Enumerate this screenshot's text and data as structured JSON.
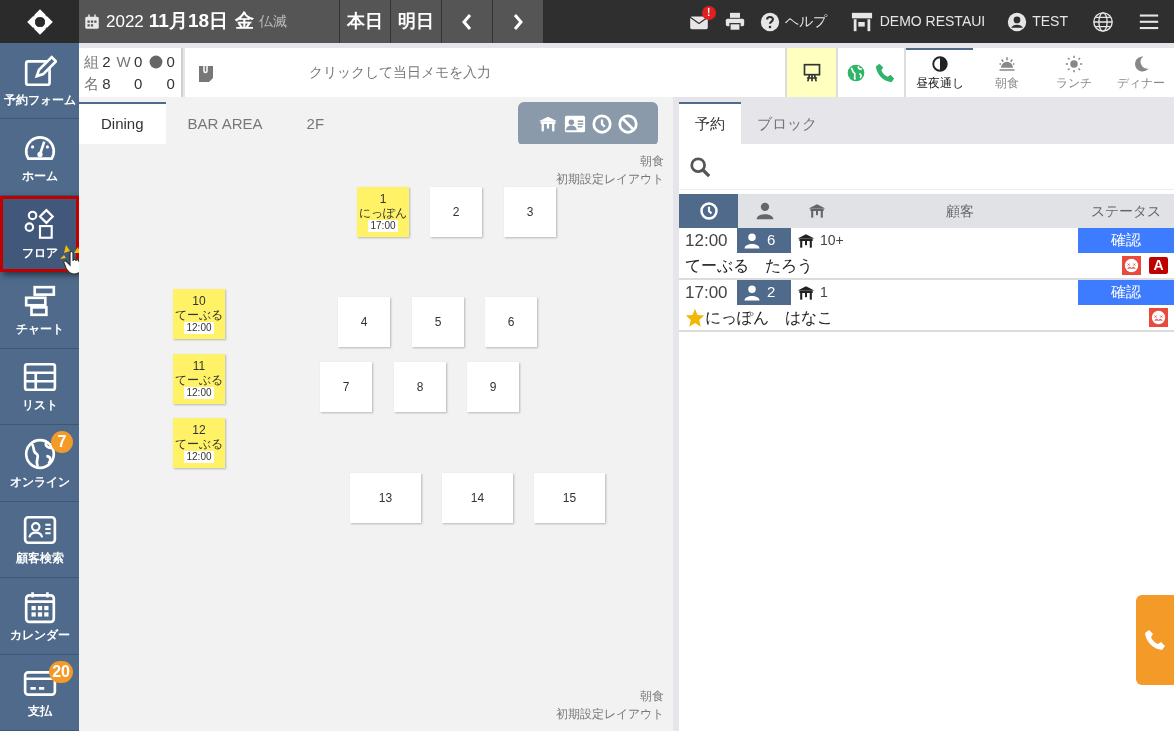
{
  "header": {
    "year": "2022",
    "date": "11月18日",
    "weekday": "金",
    "rokuyo": "仏滅",
    "buttons": [
      "本日",
      "明日"
    ],
    "mail_badge": "!",
    "help": "ヘルプ",
    "store": "DEMO RESTAUI",
    "user": "TEST"
  },
  "sidebar": {
    "items": [
      {
        "kind": "form",
        "label": "予約フォーム",
        "selected": false
      },
      {
        "kind": "home",
        "label": "ホーム",
        "selected": false
      },
      {
        "kind": "floor",
        "label": "フロア",
        "selected": true
      },
      {
        "kind": "chart",
        "label": "チャート",
        "selected": false
      },
      {
        "kind": "list",
        "label": "リスト",
        "selected": false
      },
      {
        "kind": "online",
        "label": "オンライン",
        "selected": false,
        "badge": "7"
      },
      {
        "kind": "customer",
        "label": "顧客検索",
        "selected": false
      },
      {
        "kind": "calendar",
        "label": "カレンダー",
        "selected": false
      },
      {
        "kind": "payment",
        "label": "支払",
        "selected": false,
        "badge": "20"
      }
    ]
  },
  "summary": {
    "groups_label": "組",
    "groups": "2",
    "walkin_label": "W",
    "walkin_groups": "0",
    "online_groups": "0",
    "people_label": "名",
    "people": "8",
    "walkin_people": "0",
    "online_people": "0"
  },
  "memo": {
    "placeholder": "クリックして当日メモを入力"
  },
  "layout_toggle": {
    "on": true
  },
  "meal_tabs": [
    {
      "kind": "allday",
      "label": "昼夜通し",
      "selected": true
    },
    {
      "kind": "breakfast",
      "label": "朝食",
      "selected": false
    },
    {
      "kind": "lunch",
      "label": "ランチ",
      "selected": false
    },
    {
      "kind": "dinner",
      "label": "ディナー",
      "selected": false
    }
  ],
  "floor_tabs": [
    {
      "label": "Dining",
      "selected": true
    },
    {
      "label": "BAR AREA",
      "selected": false
    },
    {
      "label": "2F",
      "selected": false
    }
  ],
  "canvas": {
    "top_labels": [
      "朝食",
      "初期設定レイアウト"
    ],
    "bottom_labels": [
      "朝食",
      "初期設定レイアウト"
    ],
    "tables": [
      {
        "number": "1",
        "occupied": true,
        "guest": "にっぽん",
        "time": "17:00"
      },
      {
        "number": "2",
        "occupied": false
      },
      {
        "number": "3",
        "occupied": false
      },
      {
        "number": "4",
        "occupied": false
      },
      {
        "number": "5",
        "occupied": false
      },
      {
        "number": "6",
        "occupied": false
      },
      {
        "number": "7",
        "occupied": false
      },
      {
        "number": "8",
        "occupied": false
      },
      {
        "number": "9",
        "occupied": false
      },
      {
        "number": "10",
        "occupied": true,
        "guest": "てーぶる",
        "time": "12:00"
      },
      {
        "number": "11",
        "occupied": true,
        "guest": "てーぶる",
        "time": "12:00"
      },
      {
        "number": "12",
        "occupied": true,
        "guest": "てーぶる",
        "time": "12:00"
      },
      {
        "number": "13",
        "occupied": false
      },
      {
        "number": "14",
        "occupied": false
      },
      {
        "number": "15",
        "occupied": false
      }
    ]
  },
  "panel_tabs": [
    {
      "label": "予約",
      "selected": true
    },
    {
      "label": "ブロック",
      "selected": false
    }
  ],
  "list_header": {
    "sort_columns": [
      {
        "kind": "time",
        "selected": true
      },
      {
        "kind": "party",
        "selected": false
      },
      {
        "kind": "table",
        "selected": false
      }
    ],
    "customer": "顧客",
    "status": "ステータス"
  },
  "reservations": [
    {
      "time": "12:00",
      "party": "6",
      "table": "10+",
      "name": "てーぶる　たろう",
      "vip": false,
      "status": "確認",
      "tags": [
        {
          "kind": "face"
        },
        {
          "kind": "letter",
          "text": "A"
        }
      ]
    },
    {
      "time": "17:00",
      "party": "2",
      "table": "1",
      "name": "にっぽん　はなこ",
      "vip": true,
      "status": "確認",
      "tags": [
        {
          "kind": "face"
        }
      ]
    }
  ]
}
